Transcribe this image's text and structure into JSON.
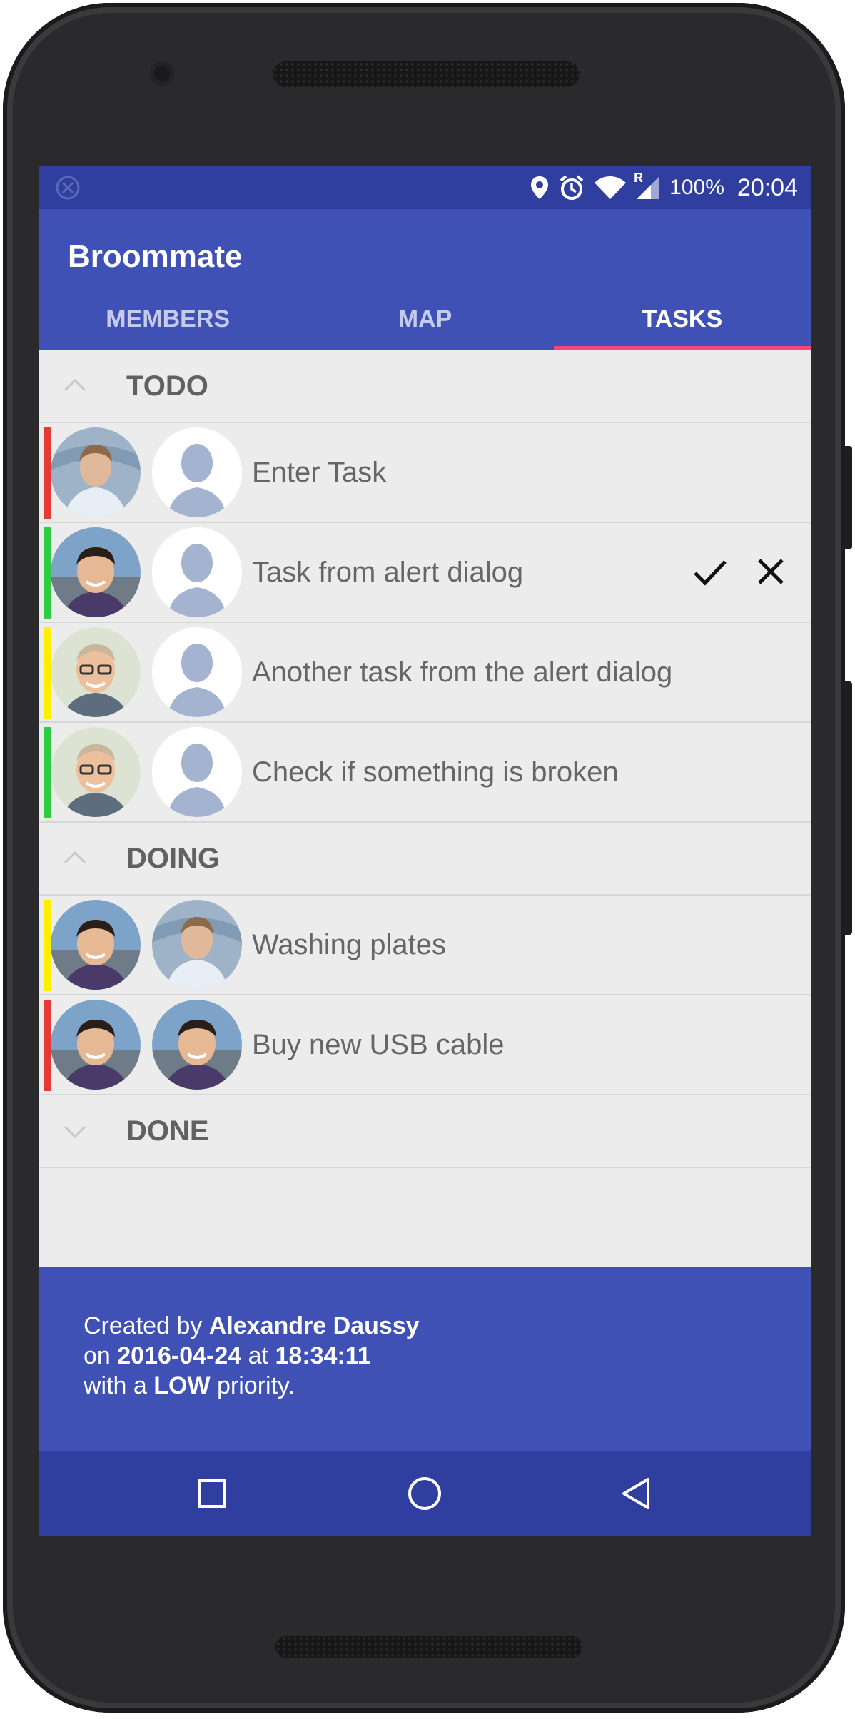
{
  "status_bar": {
    "battery": "100%",
    "time": "20:04",
    "icons": [
      "location-icon",
      "alarm-icon",
      "wifi-icon",
      "signal-icon"
    ],
    "roaming": "R"
  },
  "app": {
    "title": "Broommate"
  },
  "tabs": [
    {
      "label": "MEMBERS",
      "active": false
    },
    {
      "label": "MAP",
      "active": false
    },
    {
      "label": "TASKS",
      "active": true
    }
  ],
  "sections": [
    {
      "label": "TODO",
      "expanded": true,
      "tasks": [
        {
          "text": "Enter Task",
          "priority_color": "#e53935"
        },
        {
          "text": "Task from alert dialog",
          "priority_color": "#2ecc40",
          "actions": [
            "check-icon",
            "close-icon"
          ]
        },
        {
          "text": "Another task from the alert dialog",
          "priority_color": "#ffee00"
        },
        {
          "text": "Check if something is broken",
          "priority_color": "#2ecc40"
        }
      ]
    },
    {
      "label": "DOING",
      "expanded": true,
      "tasks": [
        {
          "text": "Washing plates",
          "priority_color": "#ffee00"
        },
        {
          "text": "Buy new USB cable",
          "priority_color": "#e53935"
        }
      ]
    },
    {
      "label": "DONE",
      "expanded": false,
      "tasks": []
    }
  ],
  "info": {
    "created_by_prefix": "Created by ",
    "creator": "Alexandre Daussy",
    "on_prefix": "on ",
    "date": "2016-04-24",
    "at_word": " at ",
    "time": "18:34:11",
    "with_prefix": "with a ",
    "priority": "LOW",
    "priority_suffix": " priority."
  },
  "colors": {
    "primary": "#3f51b5",
    "primary_dark": "#303f9f",
    "accent": "#ff4081",
    "background": "#ececec"
  }
}
